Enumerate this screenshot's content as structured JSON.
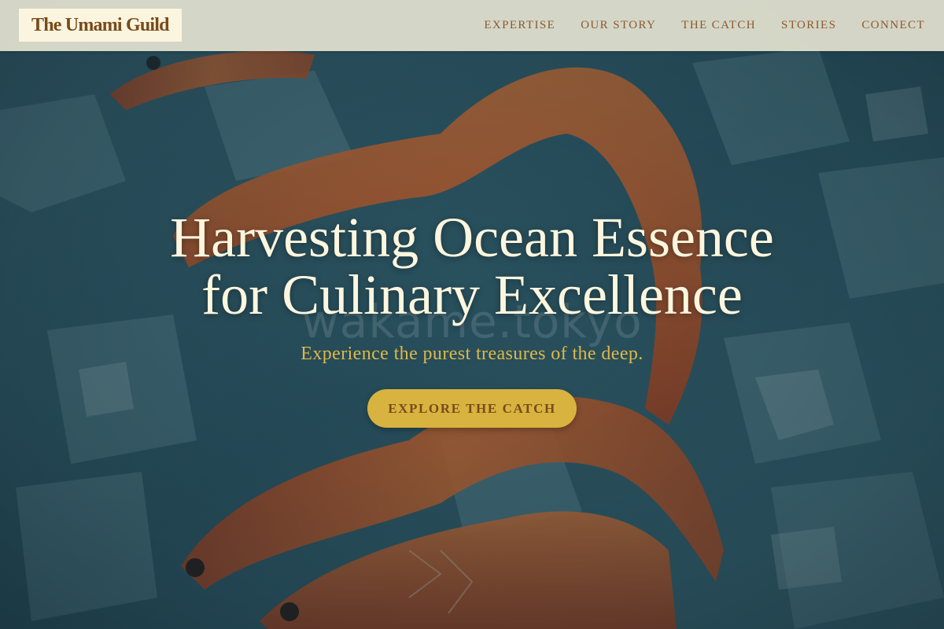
{
  "brand": {
    "name": "The Umami Guild"
  },
  "nav": {
    "items": [
      {
        "label": "EXPERTISE"
      },
      {
        "label": "OUR STORY"
      },
      {
        "label": "THE CATCH"
      },
      {
        "label": "STORIES"
      },
      {
        "label": "CONNECT"
      }
    ]
  },
  "hero": {
    "title_line1": "Harvesting Ocean Essence",
    "title_line2": "for Culinary Excellence",
    "subtitle": "Experience the purest treasures of the deep.",
    "cta_label": "EXPLORE THE CATCH",
    "watermark": "wakame.tokyo",
    "image_subject": "shrimp-on-ice-photo"
  },
  "colors": {
    "nav_background": "#e2e1d0",
    "logo_background": "#fbf5df",
    "brand_text": "#7a4a1a",
    "nav_text": "#8c5a2c",
    "title_text": "#fdf6df",
    "subtitle_text": "#e0b848",
    "cta_background": "#d8b33f",
    "cta_text": "#7a4a1a"
  }
}
